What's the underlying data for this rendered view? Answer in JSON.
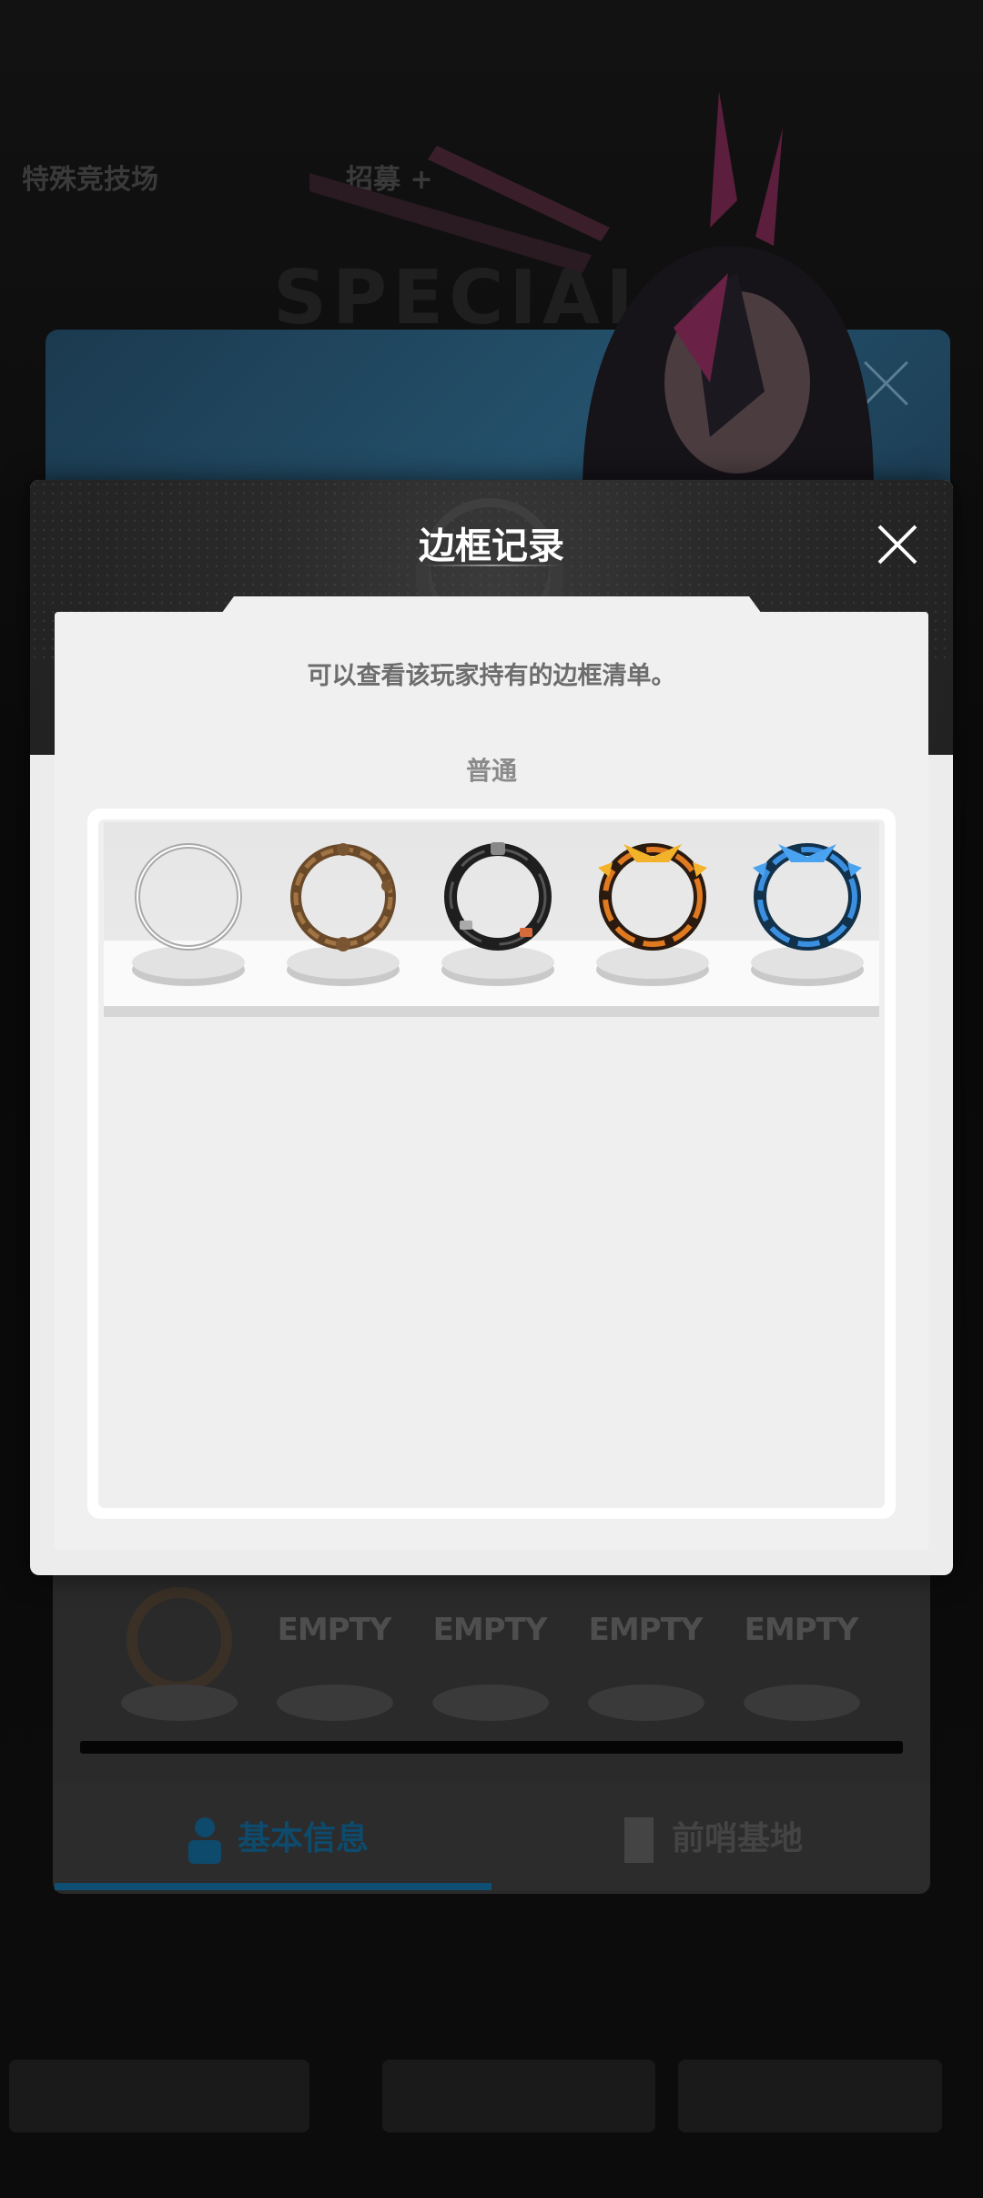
{
  "background": {
    "topbar_left": "特殊竞技场",
    "topbar_mid": "招募 +",
    "special_banner": "SPECIAL",
    "empty_slots": [
      "EMPTY",
      "EMPTY",
      "EMPTY",
      "EMPTY"
    ],
    "tabs": [
      {
        "label": "基本信息",
        "active": true
      },
      {
        "label": "前哨基地",
        "active": false
      }
    ],
    "accent_color": "#0f6fa3"
  },
  "modal": {
    "title": "边框记录",
    "description": "可以查看该玩家持有的边框清单。",
    "section_label": "普通",
    "frames": [
      {
        "name": "silver-ring-frame",
        "style": "silver"
      },
      {
        "name": "bronze-vine-frame",
        "style": "bronze"
      },
      {
        "name": "black-metal-frame",
        "style": "black"
      },
      {
        "name": "orange-gold-frame",
        "style": "orange"
      },
      {
        "name": "blue-crystal-frame",
        "style": "blue"
      }
    ],
    "icons": {
      "close": "close-icon"
    }
  }
}
